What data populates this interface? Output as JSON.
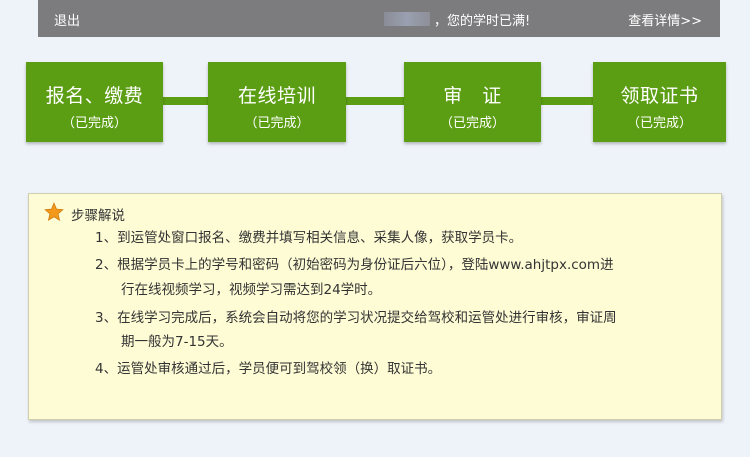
{
  "header": {
    "logout_label": "退出",
    "message": "，您的学时已满!",
    "details_link": "查看详情>>"
  },
  "steps": [
    {
      "title": "报名、缴费",
      "status": "（已完成）"
    },
    {
      "title": "在线培训",
      "status": "（已完成）"
    },
    {
      "title": "审　证",
      "status": "（已完成）"
    },
    {
      "title": "领取证书",
      "status": "（已完成）"
    }
  ],
  "colors": {
    "step_green": "#5b9e13",
    "header_gray": "#7c7c7e",
    "note_bg": "#fefcd5",
    "star_orange": "#f39a1d"
  },
  "guide": {
    "icon": "star-icon",
    "heading": "步骤解说",
    "items": [
      "1、到运管处窗口报名、缴费并填写相关信息、采集人像，获取学员卡。",
      "2、根据学员卡上的学号和密码（初始密码为身份证后六位），登陆www.ahjtpx.com进",
      "行在线视频学习，视频学习需达到24学时。",
      "3、在线学习完成后，系统会自动将您的学习状况提交给驾校和运管处进行审核，审证周",
      "期一般为7-15天。",
      "4、运管处审核通过后，学员便可到驾校领（换）取证书。"
    ]
  }
}
